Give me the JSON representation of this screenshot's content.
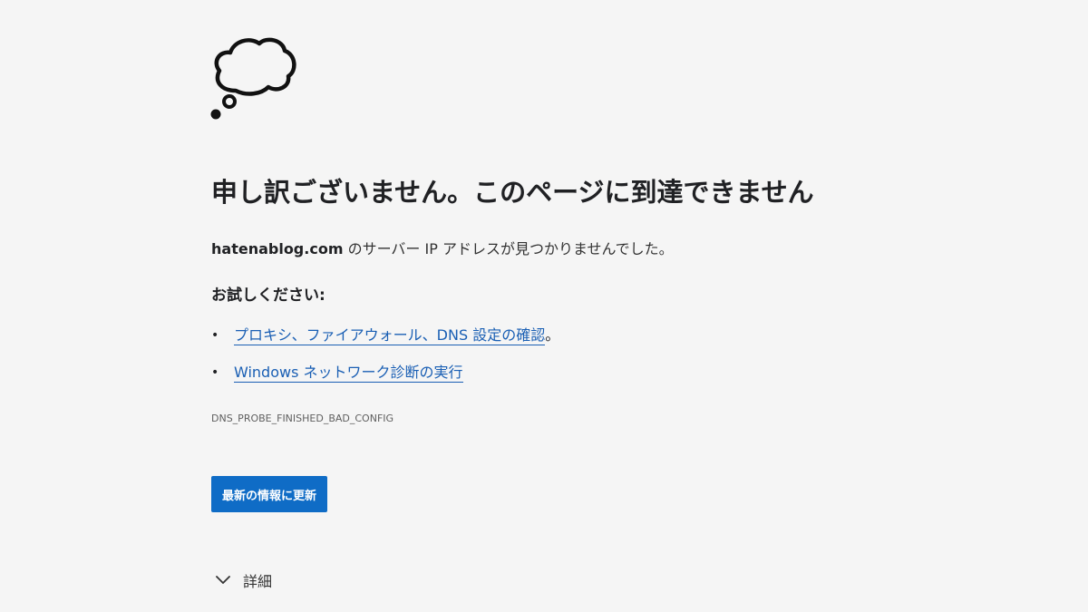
{
  "icon": {
    "name": "thought-cloud-icon"
  },
  "title": "申し訳ございません。このページに到達できません",
  "message": {
    "host": "hatenablog.com",
    "text": " のサーバー IP アドレスが見つかりませんでした。"
  },
  "try_heading": "お試しください:",
  "suggestions": [
    {
      "bullet": "•",
      "link_text": "プロキシ、ファイアウォール、DNS 設定の確認",
      "suffix": "。"
    },
    {
      "bullet": "•",
      "link_text": "Windows ネットワーク診断の実行",
      "suffix": ""
    }
  ],
  "error_code": "DNS_PROBE_FINISHED_BAD_CONFIG",
  "reload_button": {
    "label": "最新の情報に更新"
  },
  "details": {
    "label": "詳細",
    "icon": "chevron-down-icon"
  },
  "colors": {
    "background": "#f5f5f5",
    "link": "#1a5fb4",
    "button": "#0f6cc6"
  }
}
